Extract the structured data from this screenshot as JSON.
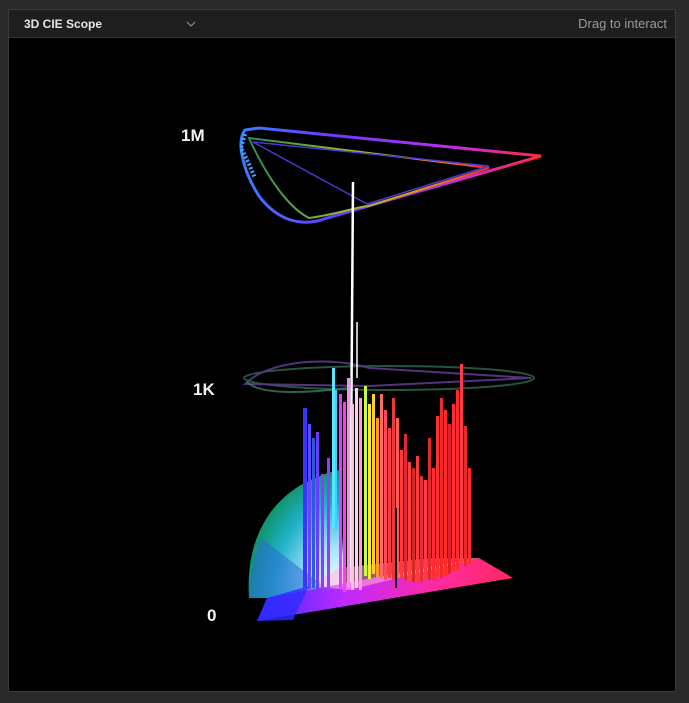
{
  "header": {
    "title": "3D CIE Scope",
    "hint": "Drag to interact"
  },
  "icons": {
    "dropdown": "chevron-down-icon"
  },
  "scope": {
    "axis_labels": [
      "1M",
      "1K",
      "0"
    ]
  },
  "colors": {
    "panel_bg": "#000000",
    "header_bg": "#1e1e1e",
    "title_text": "#e6e6e6",
    "hint_text": "#9a9a9a"
  }
}
